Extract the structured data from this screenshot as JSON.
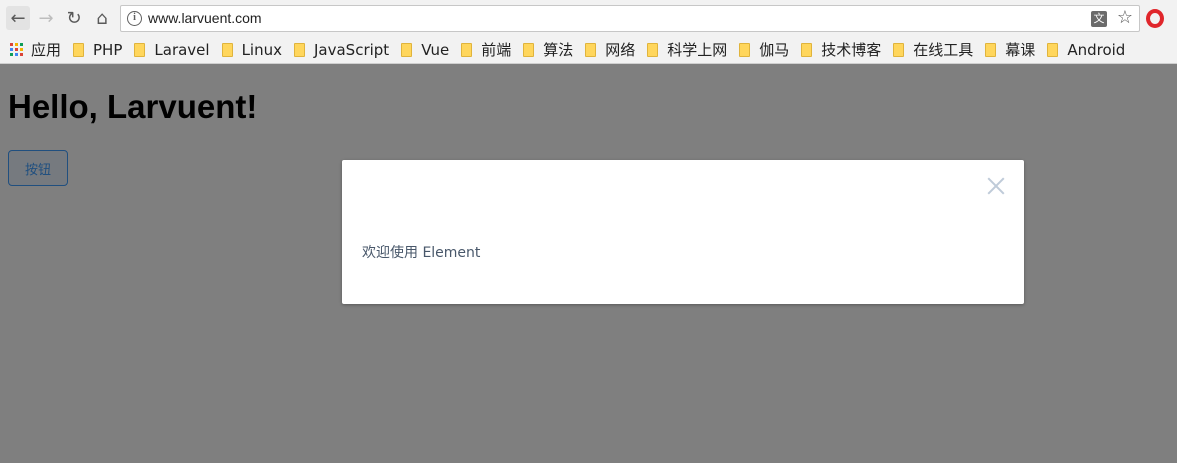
{
  "browser": {
    "url": "www.larvuent.com",
    "bookmarks": [
      {
        "label": "应用",
        "icon": "apps-grid-icon"
      },
      {
        "label": "PHP",
        "icon": "folder-icon"
      },
      {
        "label": "Laravel",
        "icon": "folder-icon"
      },
      {
        "label": "Linux",
        "icon": "folder-icon"
      },
      {
        "label": "JavaScript",
        "icon": "folder-icon"
      },
      {
        "label": "Vue",
        "icon": "folder-icon"
      },
      {
        "label": "前端",
        "icon": "folder-icon"
      },
      {
        "label": "算法",
        "icon": "folder-icon"
      },
      {
        "label": "网络",
        "icon": "folder-icon"
      },
      {
        "label": "科学上网",
        "icon": "folder-icon"
      },
      {
        "label": "伽马",
        "icon": "folder-icon"
      },
      {
        "label": "技术博客",
        "icon": "folder-icon"
      },
      {
        "label": "在线工具",
        "icon": "folder-icon"
      },
      {
        "label": "幕课",
        "icon": "folder-icon"
      },
      {
        "label": "Android",
        "icon": "folder-icon"
      }
    ]
  },
  "page": {
    "heading": "Hello, Larvuent!",
    "button_label": "按钮"
  },
  "dialog": {
    "body_text": "欢迎使用 Element"
  },
  "colors": {
    "primary": "#409eff",
    "overlay": "rgba(0,0,0,0.5)",
    "folder": "#ffd65c",
    "opera": "#e0262b"
  }
}
